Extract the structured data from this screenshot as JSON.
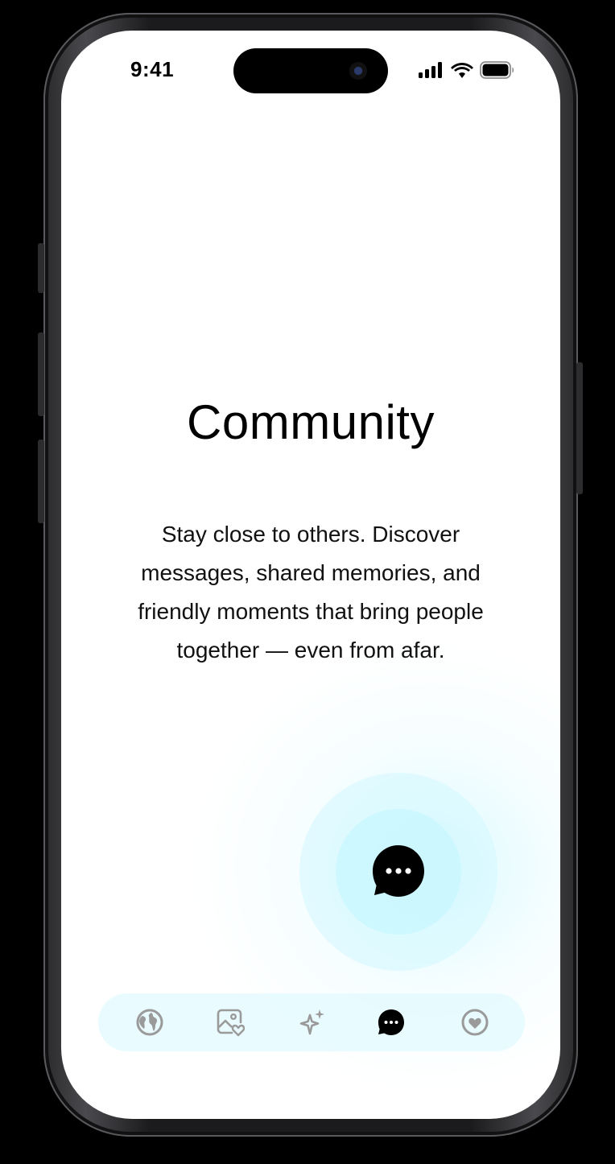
{
  "status_bar": {
    "time": "9:41"
  },
  "screen": {
    "title": "Community",
    "description": "Stay close to others. Discover messages, shared memories, and friendly moments that bring people together — even from afar."
  },
  "floating_action": {
    "icon": "chat-bubble-icon"
  },
  "tab_bar": {
    "tabs": [
      {
        "icon": "globe-icon",
        "active": false
      },
      {
        "icon": "photo-heart-icon",
        "active": false
      },
      {
        "icon": "sparkle-icon",
        "active": false
      },
      {
        "icon": "chat-bubble-icon",
        "active": true
      },
      {
        "icon": "heart-circle-icon",
        "active": false
      }
    ]
  },
  "colors": {
    "background": "#ffffff",
    "accent_glow": "#e0faff",
    "active_icon": "#000000",
    "inactive_icon": "#9a9a9a"
  }
}
